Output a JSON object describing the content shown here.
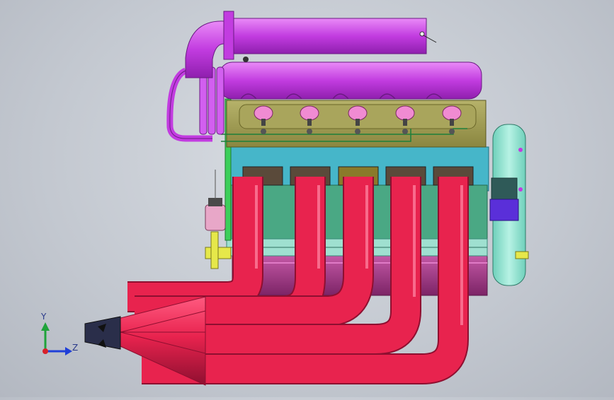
{
  "app": {
    "viewport_background": "#c8ccd3",
    "model": "five-cylinder-engine-assembly"
  },
  "triad": {
    "y_label": "Y",
    "z_label": "Z",
    "x_color": "#d8202a",
    "y_color": "#1fa33a",
    "z_color": "#1f3fd8"
  },
  "colors": {
    "intake": "#c23ce0",
    "intake_light": "#e27cf5",
    "head": "#9e9a52",
    "block_cyan": "#46b6c9",
    "block_green": "#4aa884",
    "pan": "#a43a8c",
    "header": "#e8234e",
    "flywheel": "#8fe3cf",
    "pulley": "#5a2fd9",
    "shaft": "#e6e84a",
    "filter": "#e8a7c8"
  }
}
